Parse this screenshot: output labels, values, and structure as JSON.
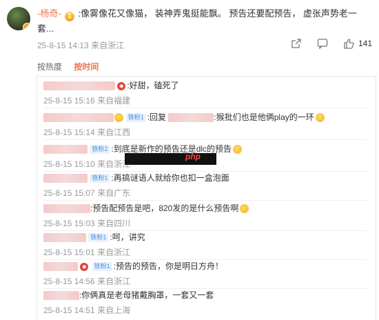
{
  "post": {
    "author": "-杨奇-",
    "level_badge": "1",
    "text": ":像雾像花又像猫， 装神弄鬼挺能飘。 预告还要配预告， 虚张声势老一套...",
    "timestamp": "25-8-15 14:13",
    "location": "来自浙江",
    "like_count": "141"
  },
  "sort": {
    "hot": "按热度",
    "time": "按时间"
  },
  "comments": [
    {
      "text": ":好甜，磕死了",
      "time": "25-8-15 15:16",
      "location": "来自福建",
      "tag": ""
    },
    {
      "text": ":回复",
      "text2": ":猴批们也是他俩play的一环",
      "time": "25-8-15 15:14",
      "location": "来自江西",
      "tag": "铁粉1"
    },
    {
      "text": ":到底是新作的预告还是dlc的预告",
      "time": "25-8-15 15:10",
      "location": "来自浙江",
      "tag": "铁粉2"
    },
    {
      "text": ":再搞谜语人就给你也扣一盒泡面",
      "time": "25-8-15 15:07",
      "location": "来自广东",
      "tag": "铁粉1"
    },
    {
      "text": ":预告配预告是吧，820发的是什么预告啊",
      "time": "25-8-15 15:03",
      "location": "来自四川",
      "tag": ""
    },
    {
      "text": ":呵，讲究",
      "time": "25-8-15 15:01",
      "location": "来自浙江",
      "tag": "铁粉1"
    },
    {
      "text": ":预告的预告，你是明日方舟！",
      "time": "25-8-15 14:56",
      "location": "来自浙江",
      "tag": "铁粉1"
    },
    {
      "text": ":你俩真是老母猪戴胸罩，一套又一套",
      "time": "25-8-15 14:51",
      "location": "来自上海",
      "tag": ""
    }
  ],
  "watermark": {
    "text": "php"
  },
  "colors": {
    "accent": "#eb7350",
    "meta": "#999999",
    "tag": "#4a8fe0"
  }
}
